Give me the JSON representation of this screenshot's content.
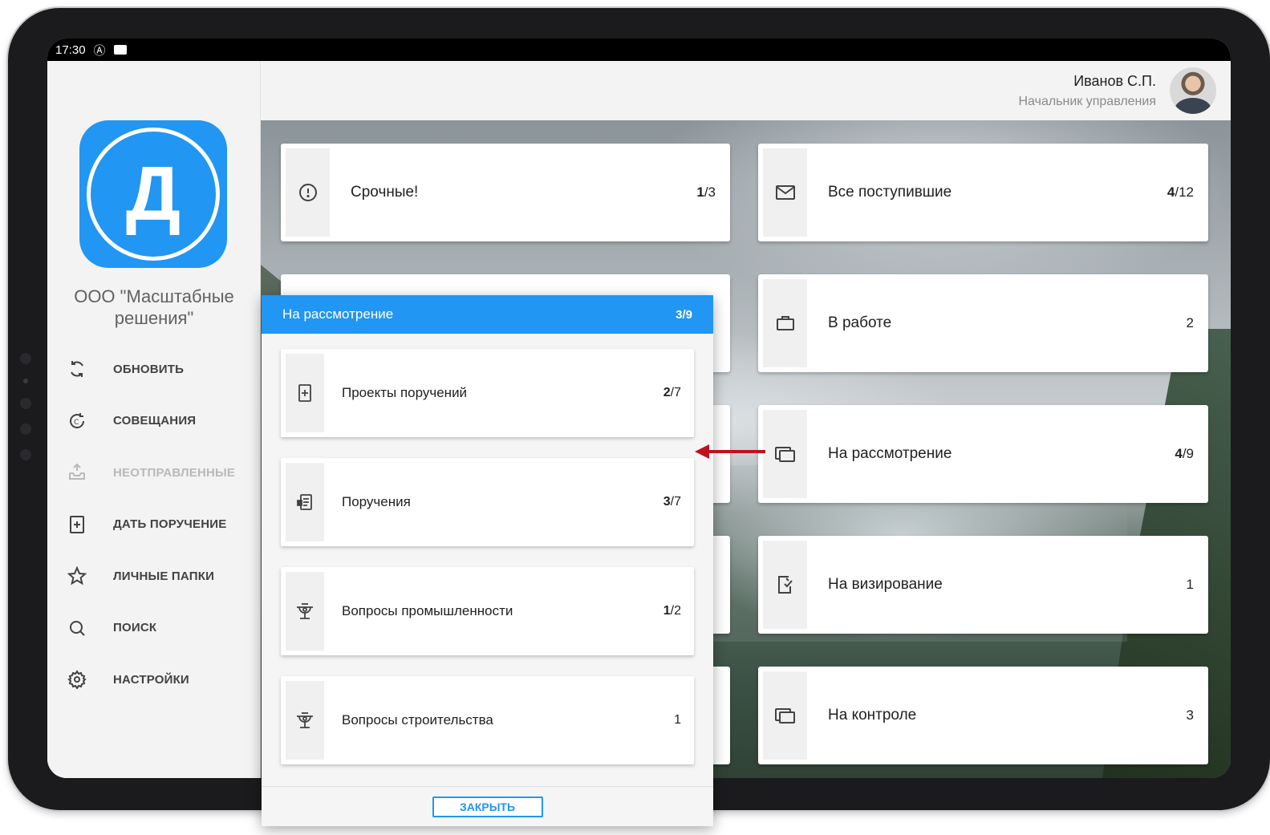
{
  "status_bar": {
    "time": "17:30",
    "icon_at": "Ⓐ"
  },
  "sidebar": {
    "logo_letter": "Д",
    "company_name": "ООО \"Масштабные решения\"",
    "menu": [
      {
        "label": "ОБНОВИТЬ",
        "icon": "refresh-icon",
        "enabled": true
      },
      {
        "label": "СОВЕЩАНИЯ",
        "icon": "meetings-icon",
        "enabled": true
      },
      {
        "label": "НЕОТПРАВЛЕННЫЕ",
        "icon": "outbox-icon",
        "enabled": false
      },
      {
        "label": "ДАТЬ ПОРУЧЕНИЕ",
        "icon": "add-document-icon",
        "enabled": true
      },
      {
        "label": "ЛИЧНЫЕ ПАПКИ",
        "icon": "star-icon",
        "enabled": true
      },
      {
        "label": "ПОИСК",
        "icon": "search-icon",
        "enabled": true
      },
      {
        "label": "НАСТРОЙКИ",
        "icon": "gear-icon",
        "enabled": true
      }
    ]
  },
  "header": {
    "user_name": "Иванов С.П.",
    "user_role": "Начальник управления"
  },
  "tiles": [
    {
      "label": "Срочные!",
      "count_bold": "1",
      "count_rest": "/3",
      "icon": "alert-icon"
    },
    {
      "label": "Все поступившие",
      "count_bold": "4",
      "count_rest": "/12",
      "icon": "mail-icon"
    },
    {
      "label": "В работе",
      "count_bold": "",
      "count_rest": "2",
      "icon": "briefcase-icon"
    },
    {
      "label": "На рассмотрение",
      "count_bold": "4",
      "count_rest": "/9",
      "icon": "folders-icon"
    },
    {
      "label": "На визирование",
      "count_bold": "",
      "count_rest": "1",
      "icon": "sign-document-icon"
    },
    {
      "label": "На контроле",
      "count_bold": "",
      "count_rest": "3",
      "icon": "folders-icon"
    }
  ],
  "popup": {
    "title": "На рассмотрение",
    "count": "3/9",
    "items": [
      {
        "label": "Проекты поручений",
        "count_bold": "2",
        "count_rest": "/7",
        "icon": "add-document-icon"
      },
      {
        "label": "Поручения",
        "count_bold": "3",
        "count_rest": "/7",
        "icon": "order-document-icon"
      },
      {
        "label": "Вопросы промышленности",
        "count_bold": "1",
        "count_rest": "/2",
        "icon": "industry-icon"
      },
      {
        "label": "Вопросы строительства",
        "count_bold": "",
        "count_rest": "1",
        "icon": "industry-icon"
      }
    ],
    "close_label": "ЗАКРЫТЬ"
  },
  "colors": {
    "accent": "#2196f3",
    "arrow": "#c0111f",
    "disabled": "#b9b9b9"
  }
}
